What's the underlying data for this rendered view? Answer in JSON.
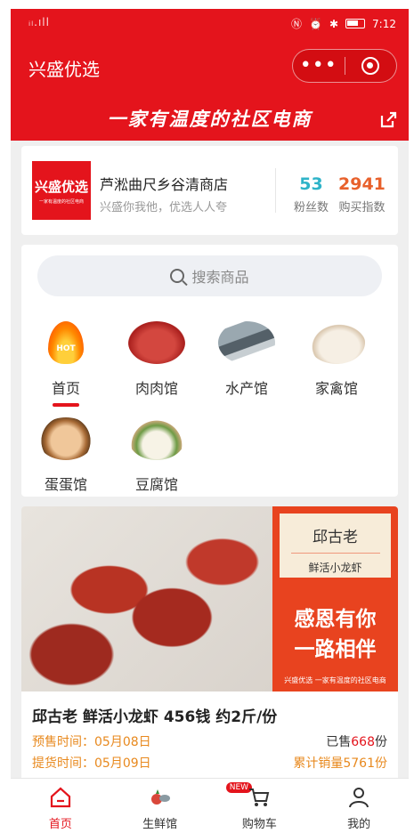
{
  "status": {
    "time": "7:12",
    "signal": "ᵢₗ.ıll"
  },
  "header": {
    "title": "兴盛优选",
    "menu_label": "•••",
    "slogan": "一家有温度的社区电商"
  },
  "store": {
    "logo_name": "兴盛优选",
    "logo_sub": "一家有温度的社区电商",
    "name": "芦淞曲尺乡谷清商店",
    "tagline": "兴盛你我他，优选人人夸",
    "fans_count": "53",
    "fans_label": "粉丝数",
    "buy_index": "2941",
    "buy_label": "购买指数"
  },
  "search": {
    "placeholder": "搜索商品"
  },
  "categories": [
    {
      "label": "首页",
      "icon": "hot-flame-icon",
      "badge": "HOT"
    },
    {
      "label": "肉肉馆",
      "icon": "meat-icon"
    },
    {
      "label": "水产馆",
      "icon": "fish-icon"
    },
    {
      "label": "家禽馆",
      "icon": "poultry-icon"
    },
    {
      "label": "蛋蛋馆",
      "icon": "eggs-icon"
    },
    {
      "label": "豆腐馆",
      "icon": "tofu-icon"
    }
  ],
  "product": {
    "banner_brand": "邱古老",
    "banner_sub": "鲜活小龙虾",
    "banner_slogan_1": "感恩有你",
    "banner_slogan_2": "一路相伴",
    "banner_footer": "兴盛优选 一家有温度的社区电商",
    "title": "邱古老 鲜活小龙虾 456钱 约2斤/份",
    "presale": "预售时间：05月08日",
    "pickup": "提货时间：05月09日",
    "sold_prefix": "已售",
    "sold_count": "668",
    "sold_suffix": "份",
    "total_sales": "累计销量5761份"
  },
  "nav": [
    {
      "label": "首页",
      "icon": "home-icon",
      "active": true
    },
    {
      "label": "生鲜馆",
      "icon": "fresh-produce-icon",
      "badge": "NEW"
    },
    {
      "label": "购物车",
      "icon": "cart-icon"
    },
    {
      "label": "我的",
      "icon": "profile-icon"
    }
  ],
  "colors": {
    "brand": "#e4141c",
    "fans": "#2eb3c8",
    "buy_index": "#e8612c",
    "accent_orange": "#e8891e"
  }
}
